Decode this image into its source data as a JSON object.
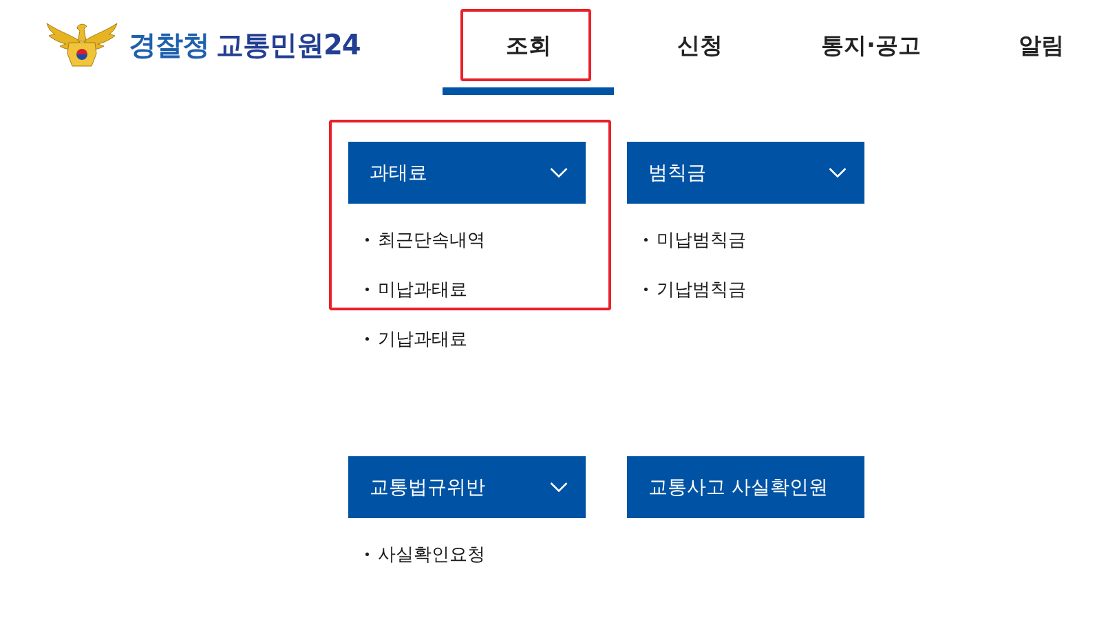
{
  "logo": {
    "agency": "경찰청",
    "service": "교통민원24"
  },
  "tabs": [
    {
      "label": "조회",
      "selected": true,
      "highlighted": true
    },
    {
      "label": "신청",
      "selected": false,
      "highlighted": false
    },
    {
      "label": "통지·공고",
      "selected": false,
      "highlighted": false
    },
    {
      "label": "알림",
      "selected": false,
      "highlighted": false
    }
  ],
  "panels": [
    {
      "title": "과태료",
      "dropdown": true,
      "highlighted": true,
      "links": [
        {
          "label": "최근단속내역",
          "highlighted": true
        },
        {
          "label": "미납과태료",
          "highlighted": true
        },
        {
          "label": "기납과태료",
          "highlighted": false
        }
      ]
    },
    {
      "title": "범칙금",
      "dropdown": true,
      "highlighted": false,
      "links": [
        {
          "label": "미납범칙금",
          "highlighted": false
        },
        {
          "label": "기납범칙금",
          "highlighted": false
        }
      ]
    },
    {
      "title": "교통법규위반",
      "dropdown": true,
      "highlighted": false,
      "links": [
        {
          "label": "사실확인요청",
          "highlighted": false
        }
      ]
    },
    {
      "title": "교통사고 사실확인원",
      "dropdown": false,
      "highlighted": false
    }
  ]
}
